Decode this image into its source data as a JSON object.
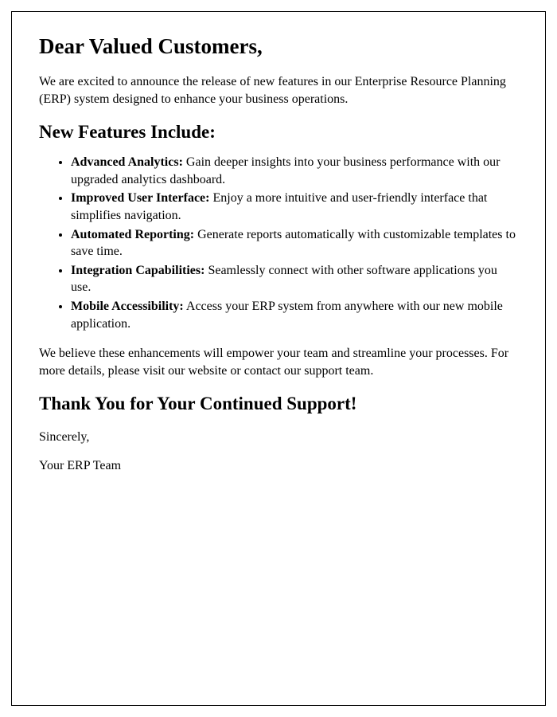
{
  "greeting": "Dear Valued Customers,",
  "intro": "We are excited to announce the release of new features in our Enterprise Resource Planning (ERP) system designed to enhance your business operations.",
  "features_heading": "New Features Include:",
  "features": [
    {
      "title": "Advanced Analytics:",
      "desc": " Gain deeper insights into your business performance with our upgraded analytics dashboard."
    },
    {
      "title": "Improved User Interface:",
      "desc": " Enjoy a more intuitive and user-friendly interface that simplifies navigation."
    },
    {
      "title": "Automated Reporting:",
      "desc": " Generate reports automatically with customizable templates to save time."
    },
    {
      "title": "Integration Capabilities:",
      "desc": " Seamlessly connect with other software applications you use."
    },
    {
      "title": "Mobile Accessibility:",
      "desc": " Access your ERP system from anywhere with our new mobile application."
    }
  ],
  "closing_text": "We believe these enhancements will empower your team and streamline your processes. For more details, please visit our website or contact our support team.",
  "thank_you": "Thank You for Your Continued Support!",
  "sincerely": "Sincerely,",
  "signature": "Your ERP Team"
}
